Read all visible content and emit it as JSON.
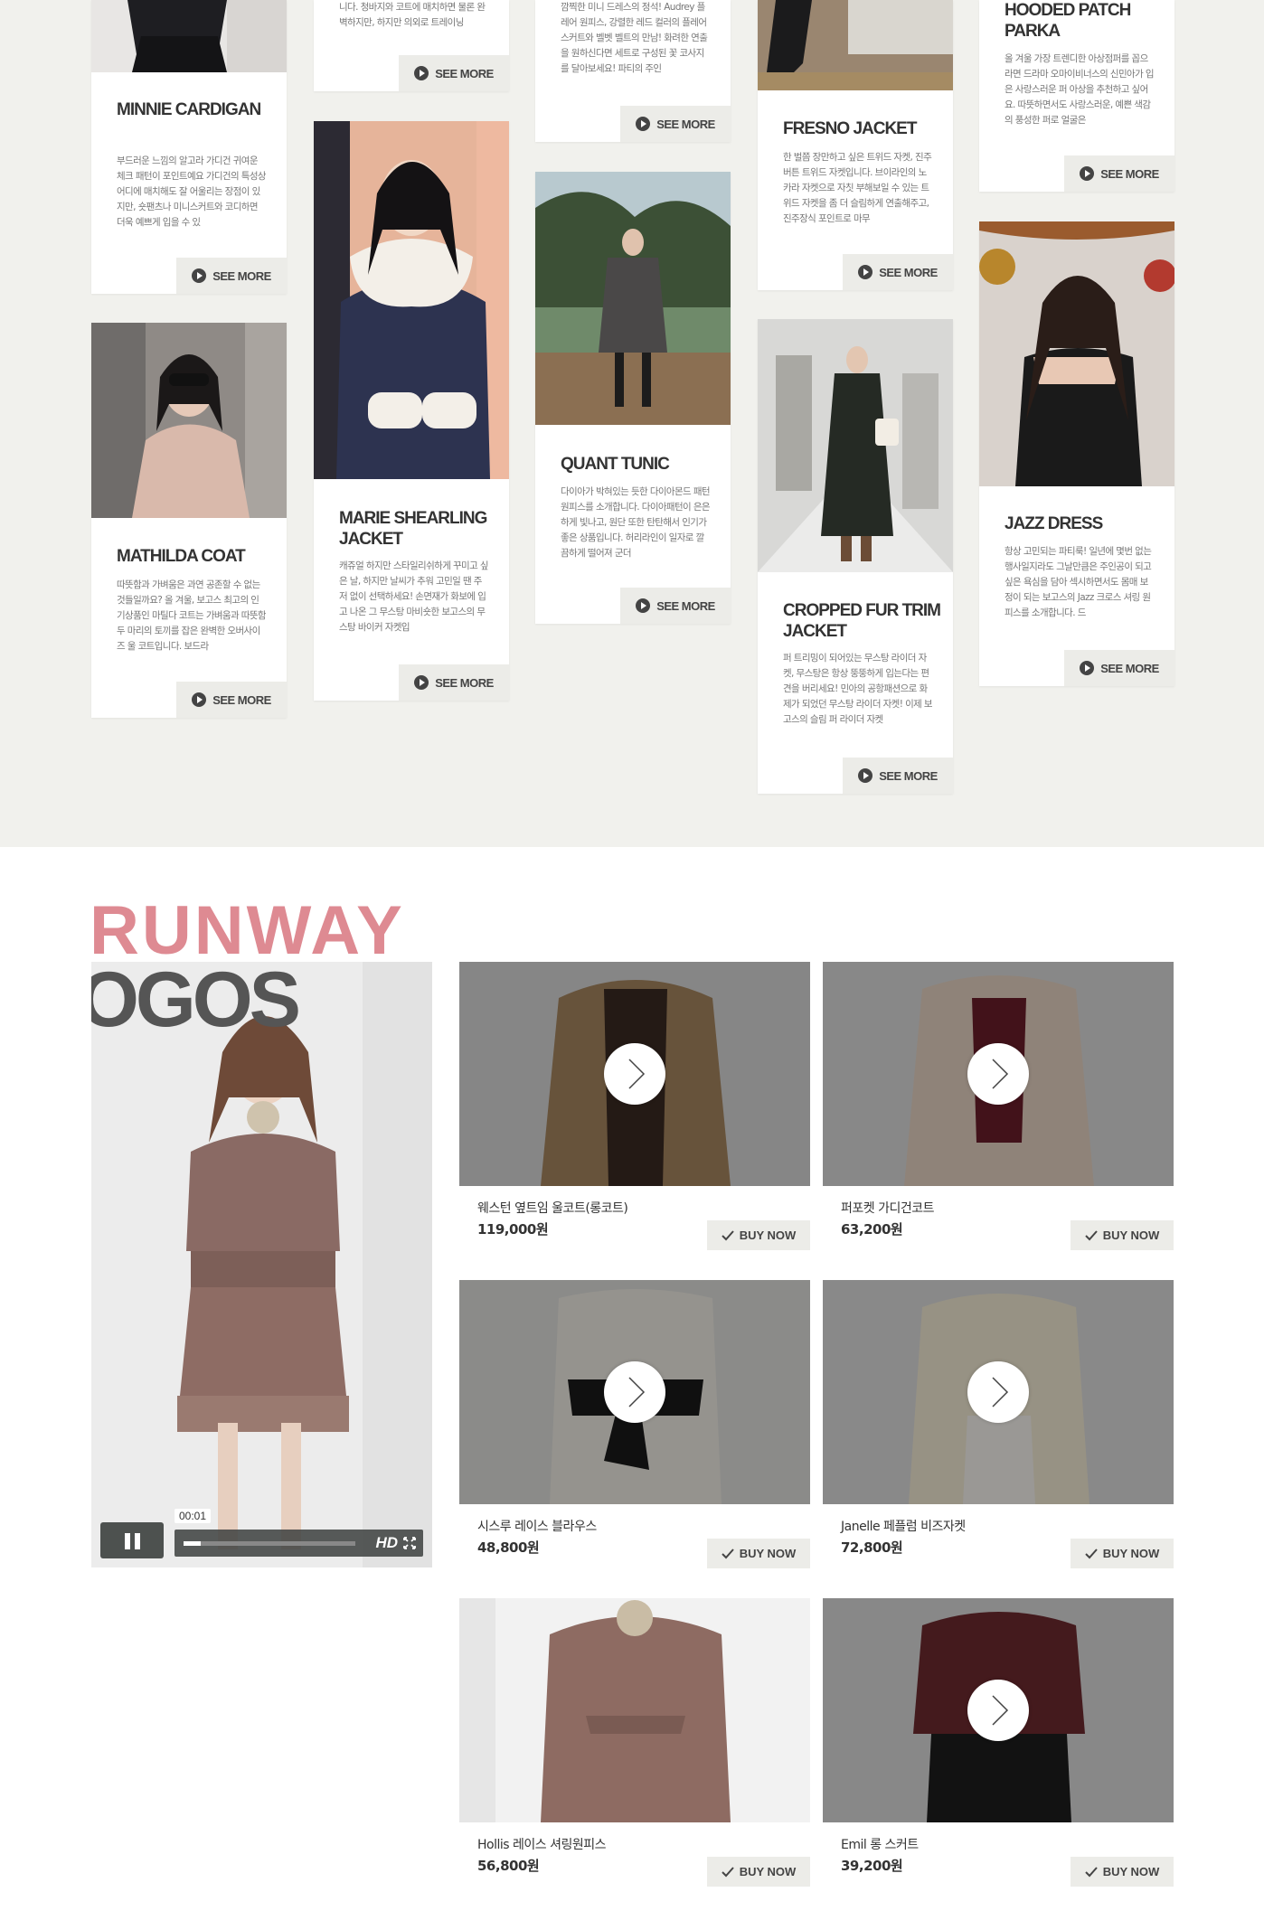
{
  "lookbook": {
    "see_more_label": "SEE MORE",
    "cards": [
      {
        "title": "MINNIE CARDIGAN",
        "desc": "부드러운 느낌의 알고라 가디건 귀여운 체크 패턴이 포인트예요 가디건의 특성상 어디에 매치해도 잘 어울리는 장점이 있지만, 숏팬츠나 미니스커트와 코디하면 더욱 예쁘게 입을 수 있"
      },
      {
        "title": "MATHILDA COAT",
        "desc": "따뜻함과 가벼움은 과연 공존할 수 없는 것들일까요? 올 겨울, 보고스 최고의 인기상품인 마틸다 코트는 가벼움과 따뜻함 두 마리의 토끼를 잡은 완벽한 오버사이즈 울 코트입니다. 보드라"
      },
      {
        "title": "",
        "desc": "니다. 청바지와 코트에 매치하면 물론 완벽하지만, 하지만 의외로 트레이닝"
      },
      {
        "title": "MARIE SHEARLING JACKET",
        "desc": "캐쥬얼 하지만 스타일리쉬하게 꾸미고 싶은 날, 하지만 날씨가 추워 고민일 땐 주저 없이 선택하세요! 손면재가 화보에 입고 나온 그 무스탕 마비숏한 보고스의 무스탕 바이커 자켓입"
      },
      {
        "title": "",
        "desc": "깜찍한 미니 드레스의 정석! Audrey 플레어 원피스, 강렬한 레드 컬러의 플레어스커트와 벨벳 벨트의 만남! 화려한 연출을 원하신다면 세트로 구성된 꽃 코사지를 달아보세요! 파티의 주인"
      },
      {
        "title": "QUANT TUNIC",
        "desc": "다이아가 박혀있는 듯한 다이아몬드 패턴 원피스를 소개합니다. 다이아패턴이 은은하게 빛나고, 원단 또한 탄탄해서 인기가 좋은 상품입니다. 허리라인이 일자로 깔끔하게 떨어져 군더"
      },
      {
        "title": "FRESNO JACKET",
        "desc": "한 벌쯤 장만하고 싶은 트위드 자켓, 진주버튼 트위드 자켓입니다. 브이라인의 노카라 자켓으로 자칫 부해보일 수 있는 트위드 자켓을 좀 더 슬림하게 연출해주고, 진주장식 포인트로 마무"
      },
      {
        "title": "CROPPED FUR TRIM JACKET",
        "desc": "퍼 트리밍이 되어있는 무스탕 라이더 자켓, 무스탕은 항상 뚱뚱하게 입는다는 편견을 버리세요! 민아의 공항패션으로 화제가 되었던 무스탕 라이더 자켓! 이제 보고스의 슬림 퍼 라이더 자켓"
      },
      {
        "title": "HOODED PATCH PARKA",
        "desc": "올 겨울 가장 트렌디한 아상점퍼를 꼽으라면 드라마 오마이비너스의 신민아가 입은 사랑스러운 퍼 아상을 추천하고 싶어요. 따뜻하면서도 사랑스러운, 예쁜 색감의 풍성한 퍼로 얼굴은"
      },
      {
        "title": "JAZZ DRESS",
        "desc": "항상 고민되는 파티룩! 일년에 몇번 없는 행사일지라도 그날만큼은 주인공이 되고 싶은 욕심을 담아 섹시하면서도 몸매 보정이 되는 보고스의 Jazz 크로스 셔링 원피스를 소개합니다. 드"
      }
    ]
  },
  "runway": {
    "title": "RUNWAY",
    "video": {
      "logo_text": "OGOS",
      "time": "00:01",
      "quality": "HD",
      "progress": 0.1
    },
    "buy_label": "BUY NOW",
    "products": [
      {
        "name": "웨스턴 옆트임 울코트(롱코트)",
        "price": "119,000원"
      },
      {
        "name": "퍼포켓 가디건코트",
        "price": "63,200원"
      },
      {
        "name": "시스루 레이스 블라우스",
        "price": "48,800원"
      },
      {
        "name": "Janelle 페플럼 비즈자켓",
        "price": "72,800원"
      },
      {
        "name": "Hollis 레이스 셔링원피스",
        "price": "56,800원"
      },
      {
        "name": "Emil 롱 스커트",
        "price": "39,200원"
      }
    ]
  },
  "colors": {
    "page_bg_top": "#f1f1ed",
    "accent_pink": "#de8a92",
    "button_bg": "#ecece8"
  }
}
